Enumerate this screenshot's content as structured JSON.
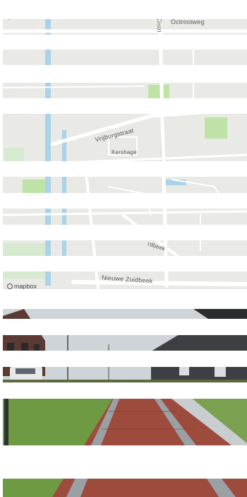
{
  "map": {
    "street_labels": {
      "octrooiweg": "Octrooiweg",
      "district": "Distri",
      "vrijburgstraat": "Vrijburgstraat",
      "kershage": "Kershage",
      "nieuwe_zuidbeek": "Nieuwe Zuidbeek",
      "vertical_road": "",
      "diagonal_road": "rdbeek"
    },
    "logo": "mapbox",
    "pin_icon": "map-pin-icon",
    "colors": {
      "land": "#e9e9e6",
      "road": "#ffffff",
      "water": "#a9d3e8",
      "park": "#bfe3a6",
      "pin": "#2e3b46"
    }
  },
  "street_view": {
    "description_icon": "street-photo"
  }
}
